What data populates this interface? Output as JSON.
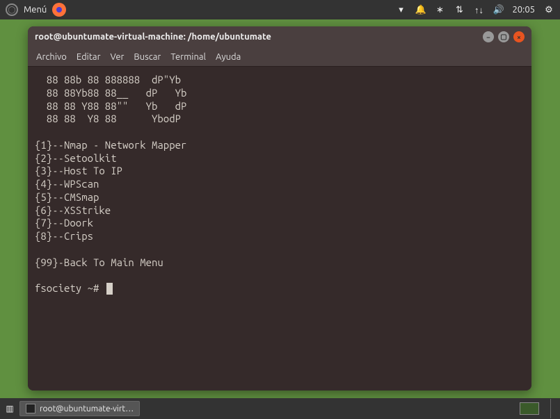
{
  "topbar": {
    "menu_label": "Menú",
    "time": "20:05"
  },
  "terminal": {
    "title": "root@ubuntumate-virtual-machine: /home/ubuntumate",
    "menus": {
      "archivo": "Archivo",
      "editar": "Editar",
      "ver": "Ver",
      "buscar": "Buscar",
      "terminal": "Terminal",
      "ayuda": "Ayuda"
    },
    "ascii": [
      "  88 88b 88 888888  dP\"Yb",
      "  88 88Yb88 88__   dP   Yb",
      "  88 88 Y88 88\"\"   Yb   dP",
      "  88 88  Y8 88      YbodP"
    ],
    "menu_items": [
      "{1}--Nmap - Network Mapper",
      "{2}--Setoolkit",
      "{3}--Host To IP",
      "{4}--WPScan",
      "{5}--CMSmap",
      "{6}--XSStrike",
      "{7}--Doork",
      "{8}--Crips"
    ],
    "back_item": "{99}-Back To Main Menu",
    "prompt": "fsociety ~# "
  },
  "taskbar": {
    "task_label": "root@ubuntumate-virt…"
  }
}
